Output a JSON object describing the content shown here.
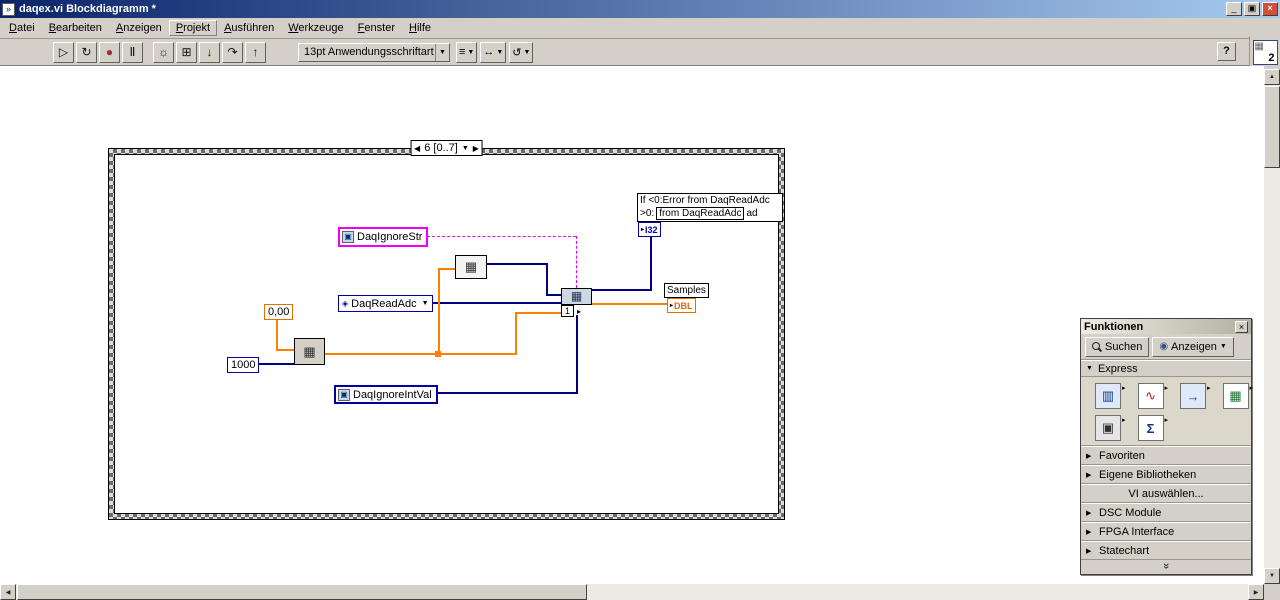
{
  "window": {
    "title": "daqex.vi Blockdiagramm *",
    "app_icon_glyph": "»",
    "minimize_glyph": "_",
    "restore_glyph": "▣",
    "close_glyph": "×",
    "help_glyph": "?",
    "vi_icon_glyph": "▦",
    "vi_icon_number": "2"
  },
  "menu": {
    "items": [
      {
        "label": "Datei"
      },
      {
        "label": "Bearbeiten"
      },
      {
        "label": "Anzeigen"
      },
      {
        "label": "Projekt"
      },
      {
        "label": "Ausführen"
      },
      {
        "label": "Werkzeuge"
      },
      {
        "label": "Fenster"
      },
      {
        "label": "Hilfe"
      }
    ]
  },
  "toolbar": {
    "buttons": [
      {
        "name": "run",
        "glyph": "▷"
      },
      {
        "name": "run-continuous",
        "glyph": "↻"
      },
      {
        "name": "abort",
        "glyph": "●"
      },
      {
        "name": "pause",
        "glyph": "Ⅱ"
      },
      {
        "name": "highlight-execution",
        "glyph": "☼"
      },
      {
        "name": "retain-wire-values",
        "glyph": "⊞"
      },
      {
        "name": "step-into",
        "glyph": "↓"
      },
      {
        "name": "step-over",
        "glyph": "↷"
      },
      {
        "name": "step-out",
        "glyph": "↑"
      }
    ],
    "font_selector": "13pt Anwendungsschriftart",
    "dropdown_arrow": "▼",
    "dropdowns": [
      {
        "name": "align-objects",
        "glyph": "≡"
      },
      {
        "name": "distribute-objects",
        "glyph": "↔"
      },
      {
        "name": "reorder-objects",
        "glyph": "↺"
      }
    ]
  },
  "diagram": {
    "case_selector": {
      "prev": "◀",
      "label": "6 [0..7]",
      "dropdown": "▼",
      "next": "▶"
    },
    "nodes": {
      "daq_ignore_str": {
        "label": "DaqIgnoreStr",
        "icon_glyph": "▣"
      },
      "daq_read_adc": {
        "label": "DaqReadAdc",
        "icon_glyph": "◈",
        "arrow": "▼"
      },
      "daq_ignore_int_val": {
        "label": "DaqIgnoreIntVal",
        "icon_glyph": "▣"
      },
      "const_zero": {
        "value": "0,00"
      },
      "const_thousand": {
        "value": "1000"
      },
      "interval_node": {
        "glyph": "▦"
      },
      "build_array_node": {
        "glyph": "▦"
      },
      "read_node": {
        "glyph": "▦",
        "index": "1",
        "run_glyph": "▸"
      },
      "samples_label": "Samples",
      "dbl_terminal": {
        "arrow": "▸",
        "label": "DBL"
      },
      "i32_terminal": {
        "arrow": "▸",
        "label": "I32"
      },
      "error_label": {
        "line1": "If <0:Error from DaqReadAdc",
        "line2_prefix": ">0:",
        "line2_boxed": "from DaqReadAdc",
        "line2_suffix": "ad"
      }
    }
  },
  "palette": {
    "title": "Funktionen",
    "close_glyph": "×",
    "search_label": "Suchen",
    "view_label": "Anzeigen",
    "view_arrow": "▼",
    "view_icon_glyph": "◉",
    "express_header": {
      "arrow": "▼",
      "label": "Express"
    },
    "subpalette_arrow": "▸",
    "express_icons": [
      {
        "name": "express-input",
        "glyph": "▥"
      },
      {
        "name": "express-signal-analysis",
        "glyph": "∿"
      },
      {
        "name": "express-output",
        "glyph": "→"
      },
      {
        "name": "express-build-table",
        "glyph": "▦"
      },
      {
        "name": "express-exec-control",
        "glyph": "▣"
      },
      {
        "name": "express-arithmetic",
        "glyph": "Σ"
      }
    ],
    "rows": [
      {
        "label": "Favoriten",
        "arrow": "▶"
      },
      {
        "label": "Eigene Bibliotheken",
        "arrow": "▶"
      },
      {
        "label": "VI auswählen...",
        "arrow": ""
      },
      {
        "label": "DSC Module",
        "arrow": "▶"
      },
      {
        "label": "FPGA Interface",
        "arrow": "▶"
      },
      {
        "label": "Statechart",
        "arrow": "▶"
      }
    ],
    "more_chevron": "»"
  },
  "scrollbar": {
    "up": "▲",
    "down": "▼",
    "left": "◀",
    "right": "▶"
  },
  "colors": {
    "titlebar_start": "#0a246a",
    "titlebar_end": "#a6caf0",
    "chrome": "#d4d0c8",
    "wire_orange": "#ff8000",
    "wire_blue": "#000080",
    "wire_string": "#f000f0"
  }
}
